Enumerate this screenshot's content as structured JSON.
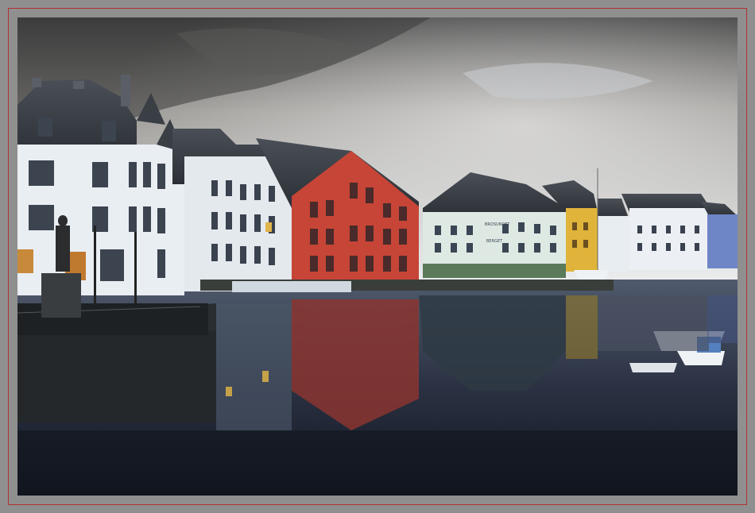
{
  "photo": {
    "alt": "Alesund harbor canal with Art Nouveau buildings reflected in the water",
    "sign_text": "BROSUNDET",
    "sign_text_2": "BERGET"
  },
  "colors": {
    "frame": "#8f8f8f",
    "frame_line": "#b03030",
    "sky_top": "#4c4c4c",
    "sky_bottom": "#e3e6ea",
    "water_top": "#5a6578",
    "water_bottom": "#151a26",
    "red_building": "#c8463a",
    "yellow_building": "#e0b23a",
    "blue_building": "#6f86c6",
    "white_building": "#e8edf2"
  }
}
